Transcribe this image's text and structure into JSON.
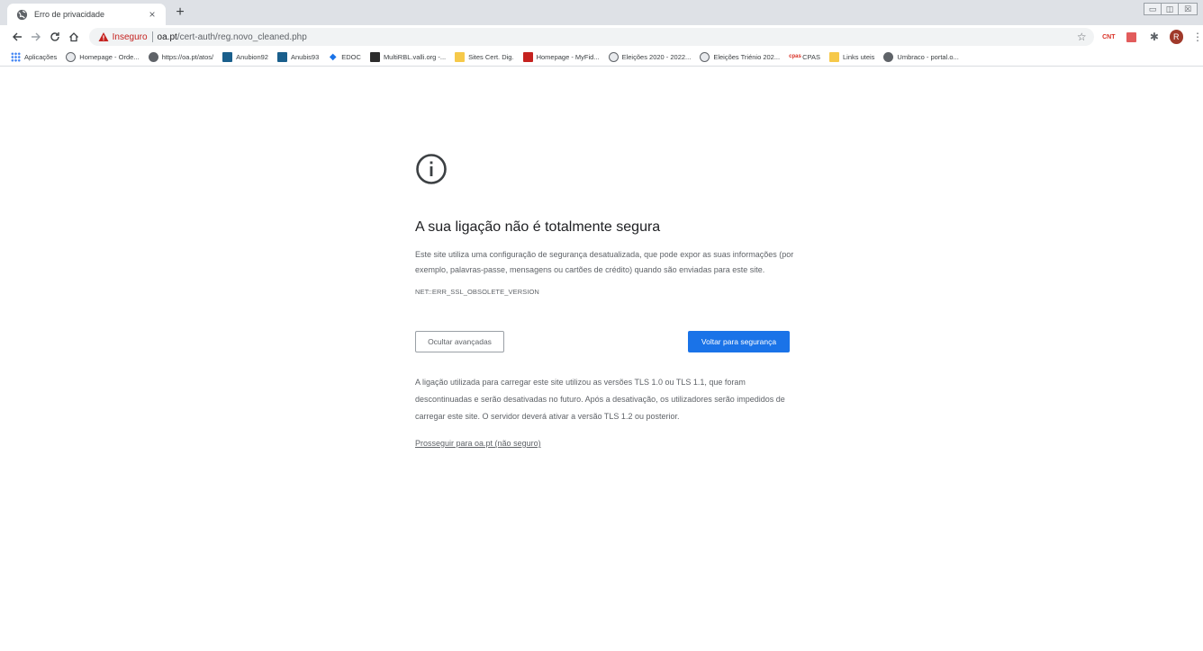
{
  "tab": {
    "title": "Erro de privacidade",
    "close": "×"
  },
  "newtab": "+",
  "window_controls": {
    "minimize": "▭",
    "restore": "◫",
    "close": "☒"
  },
  "toolbar": {
    "insecure_label": "Inseguro",
    "url_host": "oa.pt",
    "url_path": "/cert-auth/reg.novo_cleaned.php",
    "avatar_letter": "R",
    "ext_cnt_label": "CNT"
  },
  "bookmarks": [
    {
      "icon": "apps-icon",
      "label": "Aplicações"
    },
    {
      "icon": "oa-icon",
      "label": "Homepage - Orde..."
    },
    {
      "icon": "globe-icon",
      "label": "https://oa.pt/atos/"
    },
    {
      "icon": "bookmark-blue-icon",
      "label": "Anubion92"
    },
    {
      "icon": "bookmark-blue-icon",
      "label": "Anubis93"
    },
    {
      "icon": "edoc-icon",
      "label": "EDOC"
    },
    {
      "icon": "doc-icon",
      "label": "MultiRBL.valli.org -..."
    },
    {
      "icon": "folder-icon",
      "label": "Sites Cert. Dig."
    },
    {
      "icon": "myfid-icon",
      "label": "Homepage - MyFid..."
    },
    {
      "icon": "oa-icon",
      "label": "Eleições 2020 - 2022..."
    },
    {
      "icon": "oa-icon",
      "label": "Eleições Triénio 202..."
    },
    {
      "icon": "cpas-icon",
      "label": "CPAS"
    },
    {
      "icon": "folder-icon",
      "label": "Links uteis"
    },
    {
      "icon": "globe-icon",
      "label": "Umbraco - portal.o..."
    }
  ],
  "interstitial": {
    "heading": "A sua ligação não é totalmente segura",
    "description": "Este site utiliza uma configuração de segurança desatualizada, que pode expor as suas informações (por exemplo, palavras-passe, mensagens ou cartões de crédito) quando são enviadas para este site.",
    "error_code": "NET::ERR_SSL_OBSOLETE_VERSION",
    "advanced_button": "Ocultar avançadas",
    "back_button": "Voltar para segurança",
    "details": "A ligação utilizada para carregar este site utilizou as versões TLS 1.0 ou TLS 1.1, que foram descontinuadas e serão desativadas no futuro. Após a desativação, os utilizadores serão impedidos de carregar este site. O servidor deverá ativar a versão TLS 1.2 ou posterior.",
    "proceed_link": "Prosseguir para oa.pt (não seguro)"
  },
  "colors": {
    "accent": "#1a73e8",
    "insecure": "#c5221f",
    "tabstrip": "#dee1e6"
  }
}
